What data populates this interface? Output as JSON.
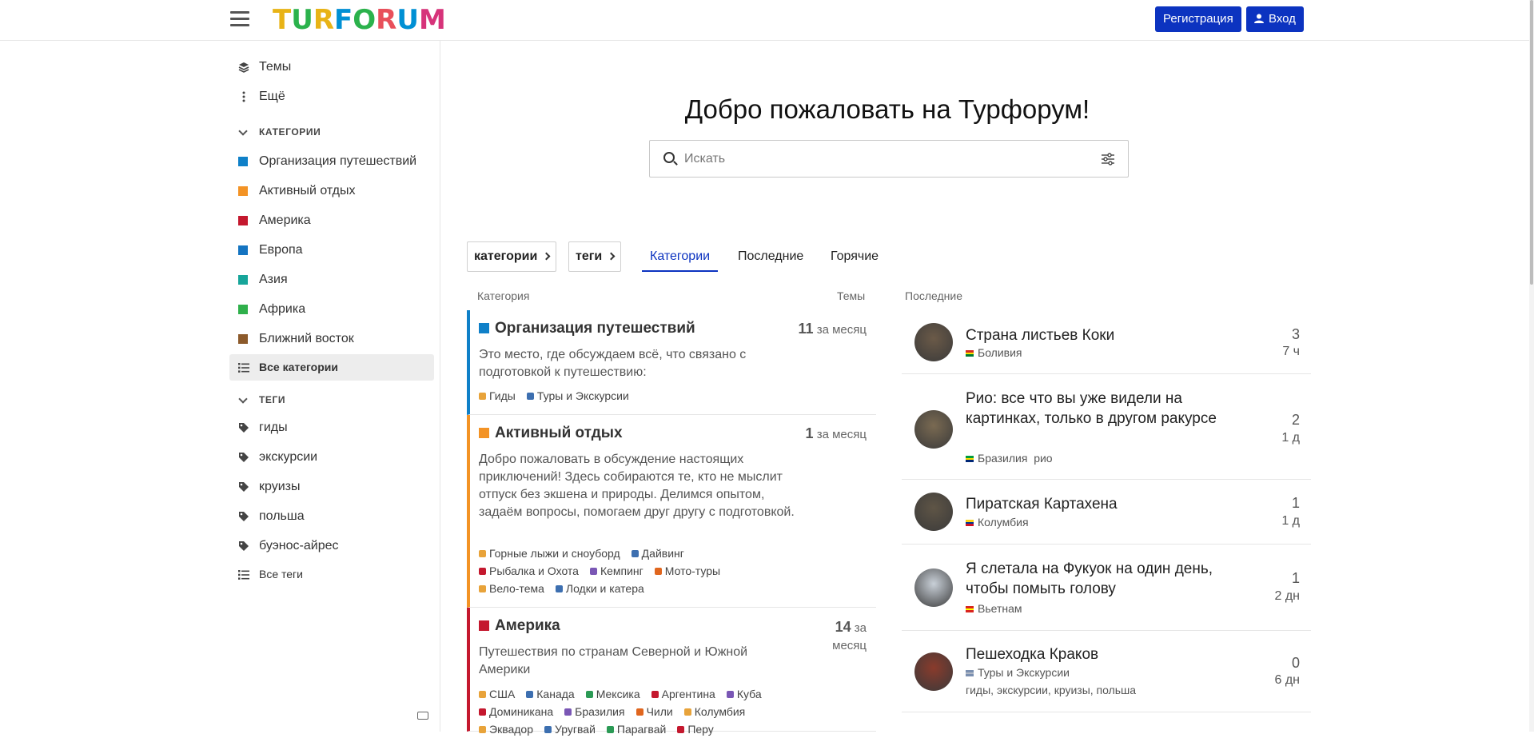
{
  "header": {
    "logo_text": "TURFORUM",
    "logo_colors": [
      "#e8b316",
      "#2bb24c",
      "#e8b316",
      "#0090d4",
      "#2bb24c",
      "#e8505b",
      "#0090d4",
      "#d6337a"
    ],
    "register_label": "Регистрация",
    "login_label": "Вход",
    "accent": "#0c33c0"
  },
  "sidebar": {
    "topics": "Темы",
    "more": "Ещё",
    "categories_head": "КАТЕГОРИИ",
    "categories": [
      {
        "label": "Организация путешествий",
        "color": "#0f80c8"
      },
      {
        "label": "Активный отдых",
        "color": "#f39325"
      },
      {
        "label": "Америка",
        "color": "#c4182e"
      },
      {
        "label": "Европа",
        "color": "#1474c1"
      },
      {
        "label": "Азия",
        "color": "#17a59a"
      },
      {
        "label": "Африка",
        "color": "#2fb04b"
      },
      {
        "label": "Ближний восток",
        "color": "#8c5a2b"
      }
    ],
    "all_categories": "Все категории",
    "tags_head": "ТЕГИ",
    "tags": [
      "гиды",
      "экскурсии",
      "круизы",
      "польша",
      "буэнос-айрес"
    ],
    "all_tags": "Все теги"
  },
  "main": {
    "welcome": "Добро пожаловать на Турфорум!",
    "search_placeholder": "Искать",
    "filter_categories": "категории",
    "filter_tags": "теги",
    "tabs": [
      "Категории",
      "Последние",
      "Горячие"
    ],
    "col_category": "Категория",
    "col_topics": "Темы",
    "col_latest": "Последние"
  },
  "categories": [
    {
      "title": "Организация путешествий",
      "color": "#0f80c8",
      "count": "11",
      "period": "за месяц",
      "description": "Это место, где обсуждаем всё, что связано с подготовкой к путешествию:",
      "subs": [
        [
          "Гиды",
          "Туры и Экскурсии"
        ]
      ]
    },
    {
      "title": "Активный отдых",
      "color": "#f39325",
      "count": "1",
      "period": "за месяц",
      "description": "Добро пожаловать в обсуждение настоящих приключений! Здесь собираются те, кто не мыслит отпуск без экшена и природы. Делимся опытом, задаём вопросы, помогаем друг другу с подготовкой.",
      "subs": [
        [
          "Горные лыжи и сноуборд",
          "Дайвинг"
        ],
        [
          "Рыбалка и Охота",
          "Кемпинг",
          "Мото-туры"
        ],
        [
          "Вело-тема",
          "Лодки и катера"
        ]
      ]
    },
    {
      "title": "Америка",
      "color": "#c4182e",
      "count": "14",
      "period": "за месяц",
      "description": "Путешествия по странам Северной и Южной Америки",
      "subs": [
        [
          "США",
          "Канада",
          "Мексика",
          "Аргентина",
          "Куба"
        ],
        [
          "Доминикана",
          "Бразилия",
          "Чили",
          "Колумбия"
        ],
        [
          "Эквадор",
          "Уругвай",
          "Парагвай",
          "Перу"
        ]
      ]
    }
  ],
  "latest": [
    {
      "title": "Страна листьев Коки",
      "category": "Боливия",
      "tags": "",
      "replies": "3",
      "age": "7 ч"
    },
    {
      "title": "Рио: все что вы уже видели на картинках, только в другом ракурсе",
      "category": "Бразилия",
      "tags": "рио",
      "replies": "2",
      "age": "1 д"
    },
    {
      "title": "Пиратская Картахена",
      "category": "Колумбия",
      "tags": "",
      "replies": "1",
      "age": "1 д"
    },
    {
      "title": "Я слетала на Фукуок на один день, чтобы помыть голову",
      "category": "Вьетнам",
      "tags": "",
      "replies": "1",
      "age": "2 дн"
    },
    {
      "title": "Пешеходка Краков",
      "category": "Туры и Экскурсии",
      "tags": "гиды, экскурсии, круизы, польша",
      "replies": "0",
      "age": "6 дн"
    }
  ]
}
